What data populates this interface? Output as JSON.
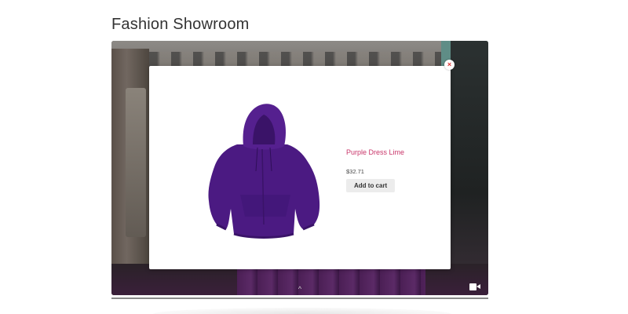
{
  "page": {
    "title": "Fashion Showroom"
  },
  "viewer": {
    "nav_arrow_glyph": "^",
    "video_icon": "video-camera-icon"
  },
  "modal": {
    "close_glyph": "×",
    "product": {
      "name": "Purple Dress Lime",
      "price": "$32.71",
      "add_to_cart_label": "Add to cart",
      "image_icon": "purple-hoodie",
      "image_color": "#4b1a82",
      "name_color": "#c9366a"
    }
  },
  "colors": {
    "close_icon": "#d9302f",
    "modal_background": "#ffffff",
    "button_background": "#ececec"
  }
}
